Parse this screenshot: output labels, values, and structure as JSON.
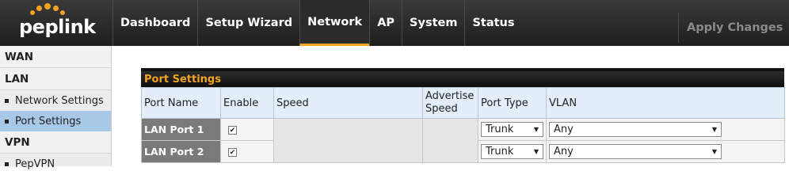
{
  "brand": {
    "name": "peplink",
    "accent": "#f3a421"
  },
  "nav": {
    "items": [
      {
        "label": "Dashboard"
      },
      {
        "label": "Setup Wizard"
      },
      {
        "label": "Network"
      },
      {
        "label": "AP"
      },
      {
        "label": "System"
      },
      {
        "label": "Status"
      }
    ],
    "active": "Network",
    "apply_label": "Apply Changes"
  },
  "sidebar": {
    "wan": "WAN",
    "lan": "LAN",
    "lan_items": [
      {
        "label": "Network Settings"
      },
      {
        "label": "Port Settings"
      }
    ],
    "vpn": "VPN",
    "vpn_items": [
      {
        "label": "PepVPN"
      }
    ]
  },
  "port_settings": {
    "title": "Port Settings",
    "columns": {
      "port_name": "Port Name",
      "enable": "Enable",
      "speed": "Speed",
      "advertise_speed": "Advertise Speed",
      "port_type": "Port Type",
      "vlan": "VLAN"
    },
    "rows": [
      {
        "name": "LAN Port 1",
        "enabled": "✔",
        "port_type": "Trunk",
        "vlan": "Any"
      },
      {
        "name": "LAN Port 2",
        "enabled": "✔",
        "port_type": "Trunk",
        "vlan": "Any"
      }
    ]
  }
}
